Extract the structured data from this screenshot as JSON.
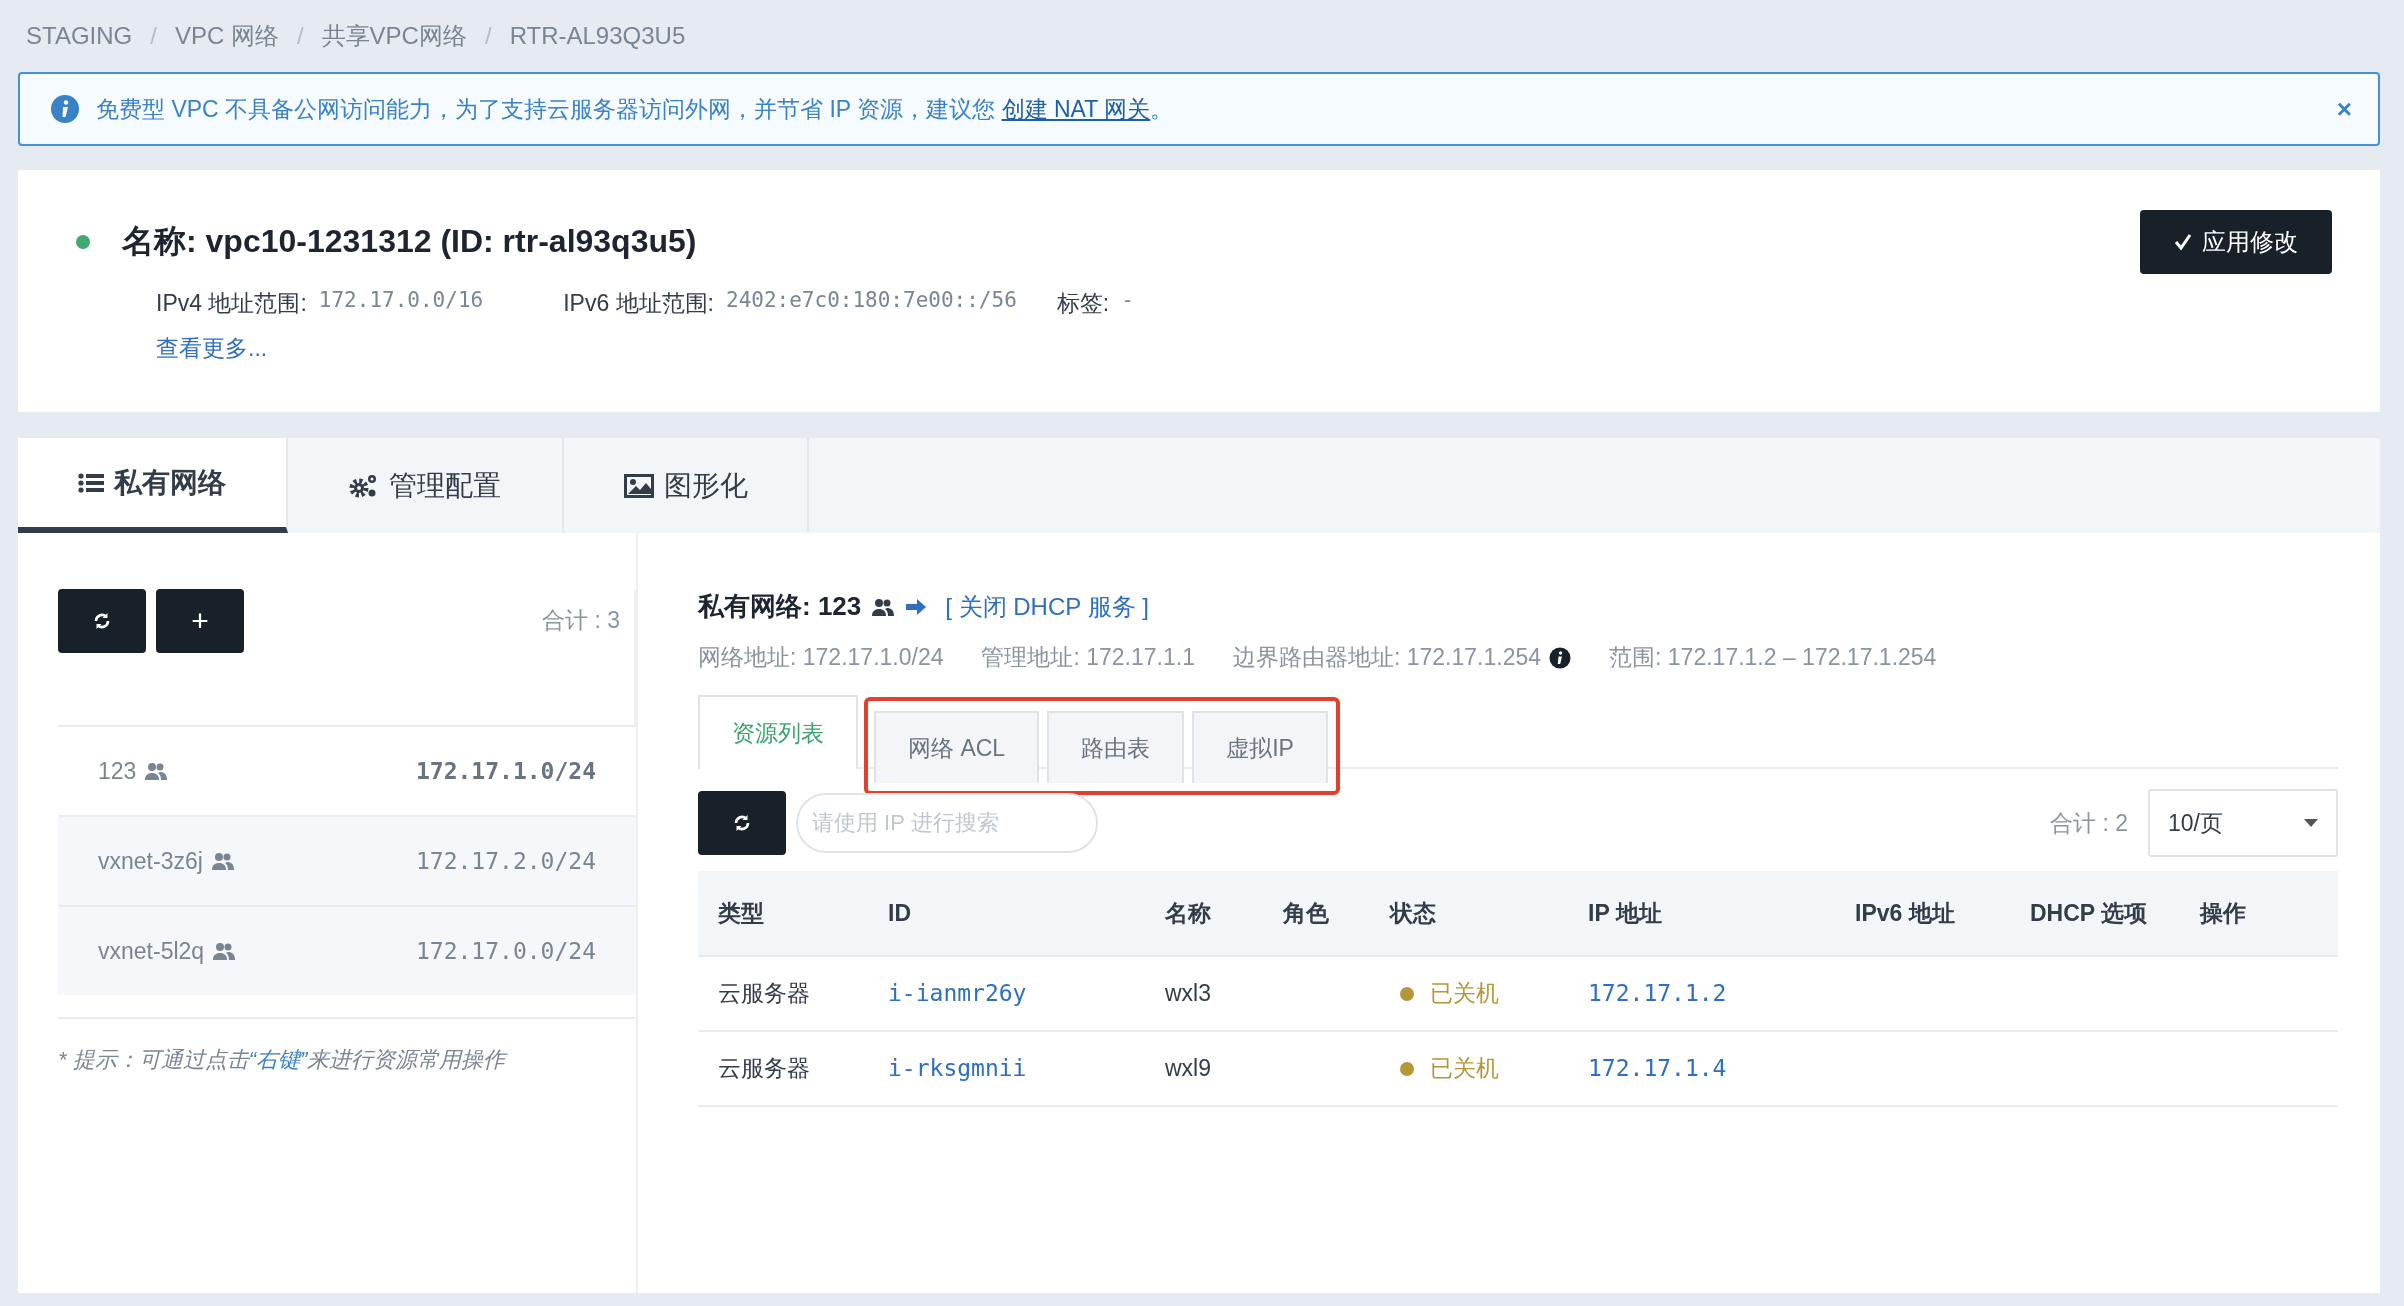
{
  "breadcrumb": {
    "separator": "/",
    "items": [
      "STAGING",
      "VPC 网络",
      "共享VPC网络",
      "RTR-AL93Q3U5"
    ]
  },
  "alert": {
    "close": "×",
    "text": "免费型 VPC 不具备公网访问能力，为了支持云服务器访问外网，并节省 IP 资源，建议您 ",
    "link": "创建 NAT 网关",
    "suffix": "。"
  },
  "vpc": {
    "title": "名称: vpc10-1231312 (ID: rtr-al93q3u5)",
    "fields": [
      {
        "label": "IPv4 地址范围:",
        "value": "172.17.0.0/16"
      },
      {
        "label": "IPv6 地址范围:",
        "value": "2402:e7c0:180:7e00::/56"
      },
      {
        "label": "标签:",
        "value": "-"
      }
    ],
    "more_link": "查看更多...",
    "apply_button": "应用修改"
  },
  "tabs": [
    {
      "label": "私有网络",
      "selected": true
    },
    {
      "label": "管理配置",
      "selected": false
    },
    {
      "label": "图形化",
      "selected": false
    }
  ],
  "sidebar": {
    "add_button": "+",
    "total": "合计 : 3",
    "items": [
      {
        "name": "123",
        "cidr": "172.17.1.0/24",
        "selected": true
      },
      {
        "name": "vxnet-3z6j",
        "cidr": "172.17.2.0/24",
        "selected": false
      },
      {
        "name": "vxnet-5l2q",
        "cidr": "172.17.0.0/24",
        "selected": false
      }
    ],
    "hint": {
      "prefix": "* 提示：可通过点击",
      "key": "“右键”",
      "suffix": "来进行资源常用操作"
    }
  },
  "detail": {
    "title": "私有网络: 123",
    "dhcp_link": "[ 关闭 DHCP 服务 ]",
    "info": [
      "网络地址: 172.17.1.0/24",
      "管理地址: 172.17.1.1",
      "边界路由器地址: 172.17.1.254",
      "范围: 172.17.1.2 – 172.17.1.254"
    ],
    "subtabs": [
      {
        "label": "资源列表",
        "selected": true,
        "highlighted": false
      },
      {
        "label": "网络 ACL",
        "selected": false,
        "highlighted": true
      },
      {
        "label": "路由表",
        "selected": false,
        "highlighted": true
      },
      {
        "label": "虚拟IP",
        "selected": false,
        "highlighted": true
      }
    ],
    "search": {
      "placeholder": "请使用 IP 进行搜索"
    },
    "total": "合计 : 2",
    "page_size": "10/页",
    "table": {
      "columns": [
        "类型",
        "ID",
        "名称",
        "角色",
        "状态",
        "IP 地址",
        "IPv6 地址",
        "DHCP 选项",
        "操作"
      ],
      "rows": [
        {
          "type": "云服务器",
          "id": "i-ianmr26y",
          "name": "wxl3",
          "status": "已关机",
          "color": "#b5973a",
          "ip": "172.17.1.2"
        },
        {
          "type": "云服务器",
          "id": "i-rksgmnii",
          "name": "wxl9",
          "status": "已关机",
          "color": "#b5973a",
          "ip": "172.17.1.4"
        }
      ]
    }
  }
}
